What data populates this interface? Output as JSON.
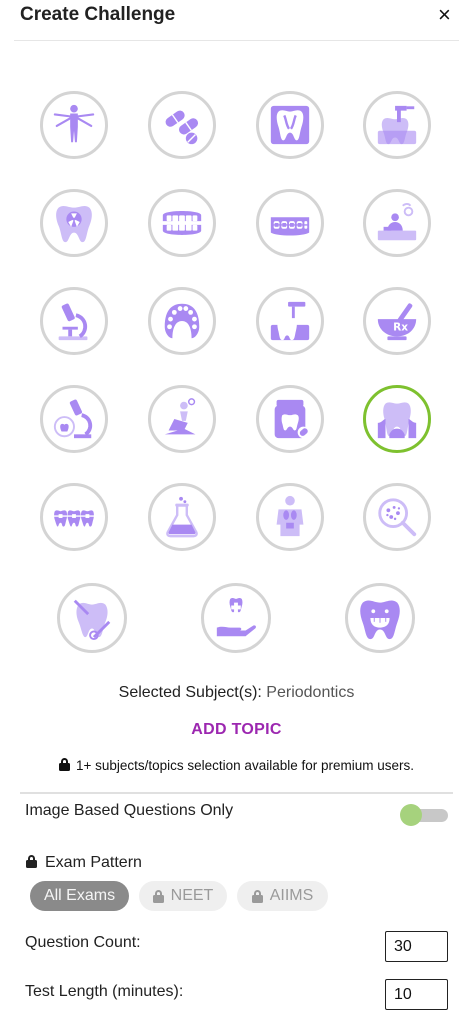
{
  "header": {
    "title": "Create Challenge",
    "close_label": "×"
  },
  "subjects": [
    {
      "name": "anatomy-icon"
    },
    {
      "name": "pharmacology-icon"
    },
    {
      "name": "dental-anatomy-icon"
    },
    {
      "name": "endodontics-icon"
    },
    {
      "name": "oral-radiology-icon"
    },
    {
      "name": "prosthodontics-icon"
    },
    {
      "name": "orthodontics-braces-icon"
    },
    {
      "name": "community-dentistry-icon"
    },
    {
      "name": "pathology-microscope-icon"
    },
    {
      "name": "removable-denture-icon"
    },
    {
      "name": "oral-surgery-icon"
    },
    {
      "name": "dental-materials-icon"
    },
    {
      "name": "oral-pathology-icon"
    },
    {
      "name": "dental-chair-icon"
    },
    {
      "name": "conservative-dentistry-icon"
    },
    {
      "name": "periodontics-icon",
      "selected": true
    },
    {
      "name": "orthodontic-appliance-icon"
    },
    {
      "name": "biochemistry-icon"
    },
    {
      "name": "physiology-icon"
    },
    {
      "name": "microbiology-icon"
    },
    {
      "name": "dental-examination-icon"
    },
    {
      "name": "public-health-icon"
    },
    {
      "name": "pedodontics-icon"
    }
  ],
  "selection": {
    "label": "Selected Subject(s):",
    "value": "Periodontics"
  },
  "add_topic_label": "ADD TOPIC",
  "premium_notice": "1+ subjects/topics selection available for premium users.",
  "image_based": {
    "label": "Image Based Questions Only",
    "enabled": true
  },
  "exam_pattern": {
    "label": "Exam Pattern",
    "options": [
      {
        "label": "All Exams",
        "active": true,
        "locked": false
      },
      {
        "label": "NEET",
        "active": false,
        "locked": true
      },
      {
        "label": "AIIMS",
        "active": false,
        "locked": true
      }
    ]
  },
  "question_count": {
    "label": "Question Count:",
    "value": "30"
  },
  "test_length": {
    "label": "Test Length (minutes):",
    "value": "10"
  },
  "colors": {
    "accent": "#9c27b0",
    "icon": "#a989f2",
    "icon_light": "#cdbdf7",
    "selected_ring": "#7ec12f",
    "toggle_thumb": "#a6d27d"
  }
}
